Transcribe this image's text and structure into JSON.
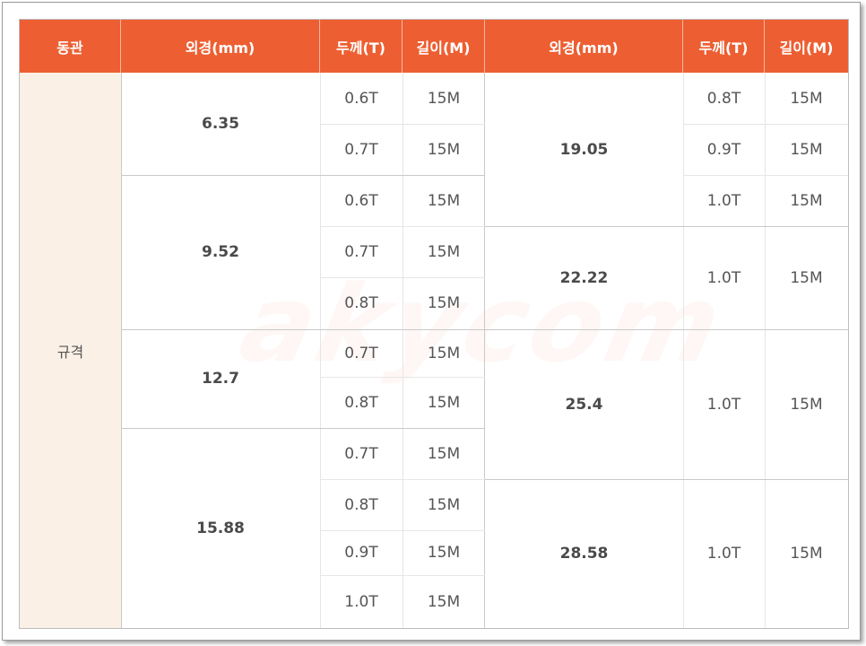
{
  "headers": [
    "동관",
    "외경(mm)",
    "두께(T)",
    "길이(M)",
    "외경(mm)",
    "두께(T)",
    "길이(M)"
  ],
  "category": "규격",
  "left_groups": [
    {
      "od": "6.35",
      "rows": [
        {
          "t": "0.6T",
          "l": "15M"
        },
        {
          "t": "0.7T",
          "l": "15M"
        }
      ]
    },
    {
      "od": "9.52",
      "rows": [
        {
          "t": "0.6T",
          "l": "15M"
        },
        {
          "t": "0.7T",
          "l": "15M"
        },
        {
          "t": "0.8T",
          "l": "15M"
        }
      ]
    },
    {
      "od": "12.7",
      "rows": [
        {
          "t": "0.7T",
          "l": "15M"
        },
        {
          "t": "0.8T",
          "l": "15M"
        }
      ]
    },
    {
      "od": "15.88",
      "rows": [
        {
          "t": "0.7T",
          "l": "15M"
        },
        {
          "t": "0.8T",
          "l": "15M"
        },
        {
          "t": "0.9T",
          "l": "15M"
        },
        {
          "t": "1.0T",
          "l": "15M"
        }
      ]
    }
  ],
  "right_groups": [
    {
      "od": "19.05",
      "rows": [
        {
          "t": "0.8T",
          "l": "15M"
        },
        {
          "t": "0.9T",
          "l": "15M"
        },
        {
          "t": "1.0T",
          "l": "15M"
        }
      ]
    },
    {
      "od": "22.22",
      "rows": [
        {
          "t": "1.0T",
          "l": "15M"
        }
      ]
    },
    {
      "od": "25.4",
      "rows": [
        {
          "t": "1.0T",
          "l": "15M"
        }
      ]
    },
    {
      "od": "28.58",
      "rows": [
        {
          "t": "1.0T",
          "l": "15M"
        }
      ]
    }
  ]
}
